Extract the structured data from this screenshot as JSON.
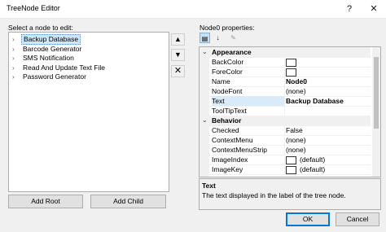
{
  "window": {
    "title": "TreeNode Editor",
    "help_glyph": "?",
    "close_glyph": "✕"
  },
  "left": {
    "label": "Select a node to edit:",
    "nodes": [
      {
        "label": "Backup Database",
        "selected": true
      },
      {
        "label": "Barcode Generator"
      },
      {
        "label": "SMS Notification"
      },
      {
        "label": "Read And Update Text File"
      },
      {
        "label": "Password Generator"
      }
    ],
    "chevron": "›",
    "add_root_label": "Add Root",
    "add_child_label": "Add Child"
  },
  "side_buttons": {
    "up": "▲",
    "down": "▼",
    "delete": "✕"
  },
  "properties": {
    "label": "Node0 properties:",
    "toolbar": {
      "categorized": "▤",
      "alphabetical": "↓",
      "property_pages": "✎"
    },
    "rows": [
      {
        "kind": "cat",
        "name": "Appearance",
        "collapse": "⌄"
      },
      {
        "kind": "prop",
        "name": "BackColor",
        "value": "",
        "swatch": true
      },
      {
        "kind": "prop",
        "name": "ForeColor",
        "value": "",
        "swatch": true
      },
      {
        "kind": "prop",
        "name": "Name",
        "value": "Node0",
        "bold": true
      },
      {
        "kind": "prop",
        "name": "NodeFont",
        "value": "(none)"
      },
      {
        "kind": "prop",
        "name": "Text",
        "value": "Backup Database",
        "bold": true,
        "selected": true
      },
      {
        "kind": "prop",
        "name": "ToolTipText",
        "value": ""
      },
      {
        "kind": "cat",
        "name": "Behavior",
        "collapse": "⌄"
      },
      {
        "kind": "prop",
        "name": "Checked",
        "value": "False"
      },
      {
        "kind": "prop",
        "name": "ContextMenu",
        "value": "(none)"
      },
      {
        "kind": "prop",
        "name": "ContextMenuStrip",
        "value": "(none)"
      },
      {
        "kind": "prop",
        "name": "ImageIndex",
        "value": "(default)",
        "swatch": true
      },
      {
        "kind": "prop",
        "name": "ImageKey",
        "value": "(default)",
        "swatch": true
      }
    ],
    "description_title": "Text",
    "description_text": "The text displayed in the label of the tree node."
  },
  "footer": {
    "ok_label": "OK",
    "cancel_label": "Cancel"
  }
}
